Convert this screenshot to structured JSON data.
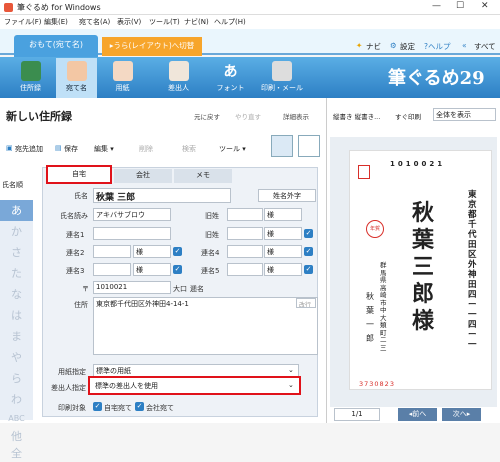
{
  "window": {
    "title": "筆ぐるめ for Windows"
  },
  "menu": [
    "ファイル(F)",
    "編集(E)",
    "宛て名(A)",
    "表示(V)",
    "ツール(T)",
    "ナビ(N)",
    "ヘルプ(H)"
  ],
  "tabs": {
    "addressee": "おもて(宛て名)",
    "switch": "▸うら(レイアウト)へ切替"
  },
  "toplinks": {
    "navi": "ナビ",
    "settings": "設定",
    "help": "?ヘルプ",
    "menu": "すべて"
  },
  "ribbon": [
    "住所録",
    "宛て名",
    "用紙",
    "差出人",
    "フォント",
    "印刷・メール"
  ],
  "logo": "筆ぐるめ29",
  "panel": {
    "title": "新しい住所録",
    "undo": "元に戻す",
    "redo": "やり直す",
    "detail": "詳細表示"
  },
  "toolbar": {
    "add": "宛先追加",
    "save": "保存",
    "edit": "編集 ▾",
    "delete": "削除",
    "search": "検索",
    "tools": "ツール ▾"
  },
  "kana_sort": "氏名順",
  "kana": [
    "あ",
    "か",
    "さ",
    "た",
    "な",
    "は",
    "ま",
    "や",
    "ら",
    "わ",
    "ABC",
    "他",
    "全"
  ],
  "form_tabs": [
    "自宅",
    "会社",
    "メモ"
  ],
  "form": {
    "name_label": "氏名",
    "name": "秋葉 三郎",
    "name_btn": "姓名外字",
    "yomi_label": "氏名読み",
    "yomi": "アキバサブロウ",
    "oldname_label": "旧姓",
    "renmei1": "連名1",
    "renmei2": "連名2",
    "renmei3": "連名3",
    "renmei4": "連名4",
    "renmei5": "連名5",
    "sama": "様",
    "zip_mark": "〒",
    "zip": "1010021",
    "oaza": "大口",
    "todo": "逓名",
    "addr_label": "住所",
    "addr": "東京都千代田区外神田4-14-1",
    "kaigyo": "改行",
    "paper_label": "用紙指定",
    "paper": "標準の用紙",
    "sender_label": "差出人指定",
    "sender": "標準の差出人を使用",
    "target_label": "印刷対象",
    "home": "自宅宛て",
    "company": "会社宛て"
  },
  "preview": {
    "zoom": "縦書き 縦書き...",
    "print": "すぐ印刷",
    "range": "全体を表示",
    "page": "1/1",
    "prev": "◂前へ",
    "next": "次へ▸"
  },
  "card": {
    "zip_digits": [
      "1",
      "0",
      "1",
      "0",
      "0",
      "2",
      "1"
    ],
    "addr": "東京都千代田区外神田四ー一四ー一",
    "name": "秋葉三郎様",
    "sender_addr": "群馬県高崎市中大類町二三",
    "sender_name": "秋葉一郎",
    "sender_zip": "3730823",
    "stamp": "年賀"
  },
  "colors": {
    "accent": "#2d7fc4",
    "red": "#e0121a"
  }
}
